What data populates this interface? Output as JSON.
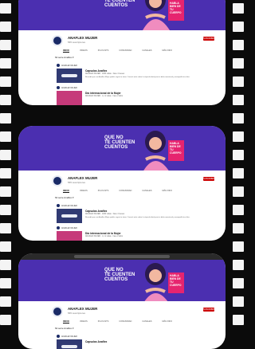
{
  "channel": {
    "name": "ANAFLEX MUJER",
    "subscribers": "565 suscriptores",
    "subscribe_label": "SUSCRIBIRSE"
  },
  "banner": {
    "headline_l1": "QUE NO",
    "headline_l2": "TE CUENTEN",
    "headline_l3": "CUENTOS",
    "badge_text": "HABLA BIEN DE TU CUERPO"
  },
  "tabs": [
    "INICIO",
    "VIDEOS",
    "PLAYLISTS",
    "COMUNIDAD",
    "CANALES",
    "MÁS INFO"
  ],
  "section_label": "Mi serie Anaflex ▾",
  "video1": {
    "title": "Capsulas Anaflex",
    "meta": "ANAFLEX MUJER · 1064 vistas · hace 4 meses",
    "desc": "Recordá que con Anaflex Mujer podés seguir tu ritmo. Conocé más sobre la cápsula ideal para tu dolor menstrual y acompañá tus días."
  },
  "video2": {
    "title": "Día internacional de la Mujer",
    "meta": "ANAFLEX MUJER · 1,1 k vistas · hace 2 años"
  },
  "colors": {
    "brand": "#4b2fb0",
    "accent": "#e6246f",
    "subscribe": "#cc0000"
  }
}
